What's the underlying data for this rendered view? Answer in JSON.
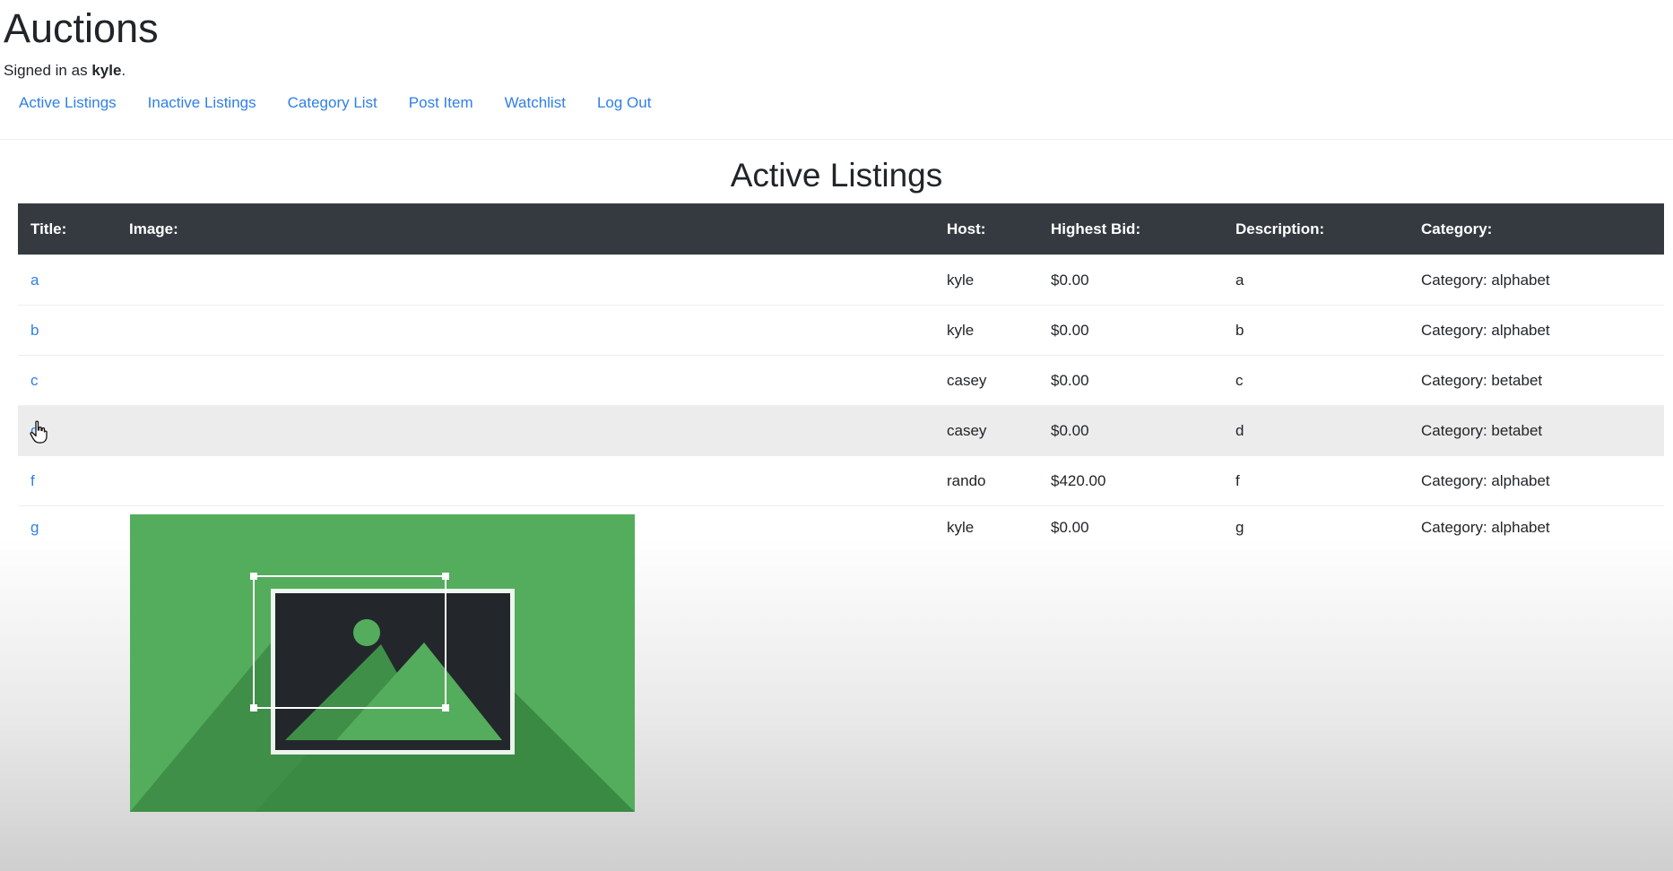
{
  "header": {
    "site_title": "Auctions",
    "signed_in_prefix": "Signed in as",
    "username": "kyle",
    "signed_in_suffix": "."
  },
  "nav": [
    {
      "label": "Active Listings"
    },
    {
      "label": "Inactive Listings"
    },
    {
      "label": "Category List"
    },
    {
      "label": "Post Item"
    },
    {
      "label": "Watchlist"
    },
    {
      "label": "Log Out"
    }
  ],
  "page": {
    "heading": "Active Listings"
  },
  "table": {
    "headers": [
      "Title:",
      "Image:",
      "Host:",
      "Highest Bid:",
      "Description:",
      "Category:"
    ],
    "rows": [
      {
        "title": "a",
        "host": "kyle",
        "bid": "$0.00",
        "description": "a",
        "category": "Category: alphabet"
      },
      {
        "title": "b",
        "host": "kyle",
        "bid": "$0.00",
        "description": "b",
        "category": "Category: alphabet"
      },
      {
        "title": "c",
        "host": "casey",
        "bid": "$0.00",
        "description": "c",
        "category": "Category: betabet"
      },
      {
        "title": "d",
        "host": "casey",
        "bid": "$0.00",
        "description": "d",
        "category": "Category: betabet"
      },
      {
        "title": "f",
        "host": "rando",
        "bid": "$420.00",
        "description": "f",
        "category": "Category: alphabet"
      },
      {
        "title": "g",
        "host": "kyle",
        "bid": "$0.00",
        "description": "g",
        "category": "Category: alphabet"
      }
    ]
  },
  "colors": {
    "link": "#2f7fe6",
    "table_header_bg": "#343a40",
    "hover_row_bg": "#ececec",
    "image_placeholder_green": "#54ad5c"
  },
  "icons": {
    "listing_image": "image-placeholder-icon",
    "cursor": "hand-pointer-icon"
  },
  "state": {
    "hovered_row": "d"
  }
}
